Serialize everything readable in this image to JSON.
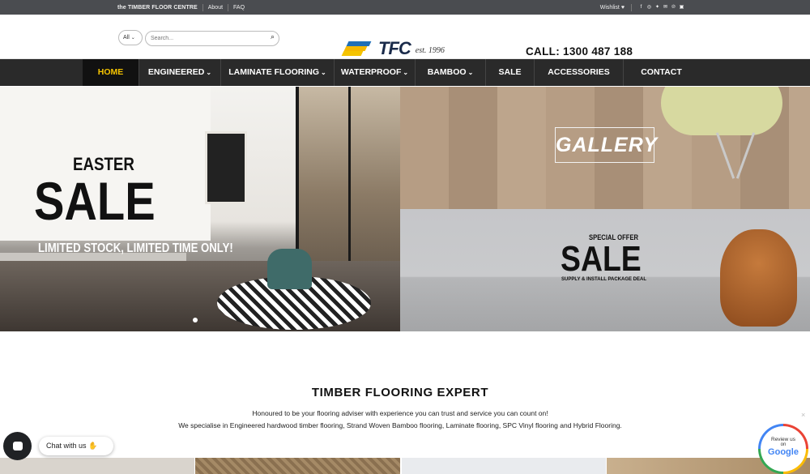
{
  "topbar": {
    "brand": "the TIMBER FLOOR CENTRE",
    "links": [
      "About",
      "FAQ"
    ],
    "wishlist": "Wishlist",
    "social_icons": [
      "facebook-icon",
      "instagram-icon",
      "twitter-icon",
      "email-icon",
      "pinterest-icon",
      "linkedin-icon"
    ]
  },
  "header": {
    "search_category": "All",
    "search_placeholder": "Search...",
    "logo_text": "TFC",
    "logo_tagline": "est. 1996",
    "phone": "CALL: 1300 487 188"
  },
  "nav": {
    "items": [
      {
        "label": "HOME",
        "active": true,
        "dropdown": false
      },
      {
        "label": "ENGINEERED",
        "dropdown": true
      },
      {
        "label": "LAMINATE FLOORING",
        "dropdown": true
      },
      {
        "label": "WATERPROOF",
        "dropdown": true
      },
      {
        "label": "BAMBOO",
        "dropdown": true
      },
      {
        "label": "SALE",
        "dropdown": false
      },
      {
        "label": "ACCESSORIES",
        "dropdown": false
      },
      {
        "label": "CONTACT",
        "dropdown": false
      }
    ]
  },
  "hero": {
    "slide_heading": "EASTER",
    "slide_sale": "SALE",
    "slide_sub": "LIMITED STOCK, LIMITED TIME ONLY!",
    "gallery_label": "GALLERY",
    "offer_top": "SPECIAL OFFER",
    "offer_sale": "SALE",
    "offer_sub": "SUPPLY & INSTALL PACKAGE DEAL"
  },
  "content": {
    "title": "TIMBER FLOORING EXPERT",
    "line1": "Honoured to be your flooring adviser with experience you can trust and service you can count on!",
    "line2": "We specialise in Engineered hardwood timber flooring, Strand Woven Bamboo flooring, Laminate flooring, SPC Vinyl flooring and Hybrid Flooring."
  },
  "widgets": {
    "chat_label": "Chat with us",
    "review_line1": "Review us",
    "review_line2": "on",
    "review_brand": "Google"
  },
  "colors": {
    "accent": "#f5c400",
    "nav_bg": "#2a2a2a",
    "topbar_bg": "#4a4c50"
  }
}
